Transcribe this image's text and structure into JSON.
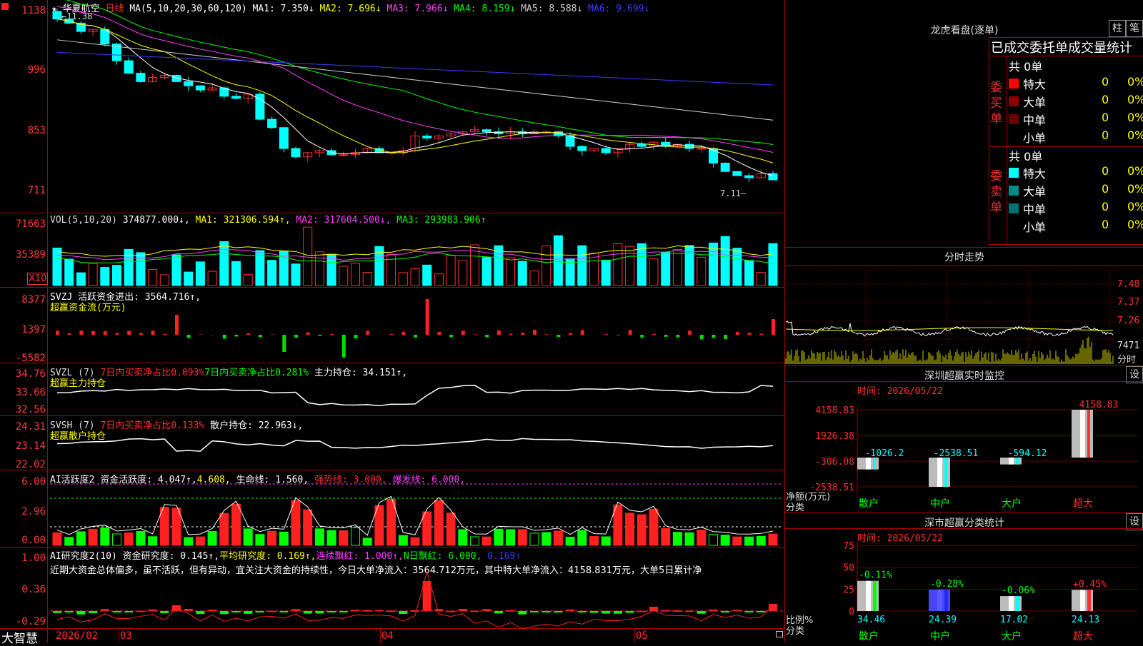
{
  "app": {
    "brand": "大智慧"
  },
  "k": {
    "star": "★",
    "name": "华夏航空",
    "period": "日线",
    "ma_label": "MA(5,10,20,30,60,120)",
    "ma": [
      {
        "t": "MA1: 7.350↓",
        "c": "#ffffff"
      },
      {
        "t": "MA2: 7.696↓",
        "c": "#ffff00"
      },
      {
        "t": "MA3: 7.966↓",
        "c": "#ff40ff"
      },
      {
        "t": "MA4: 8.159↓",
        "c": "#00ff00"
      },
      {
        "t": "MA5: 8.588↓",
        "c": "#d0d0d0"
      },
      {
        "t": "MA6: 9.699↓",
        "c": "#3b3bff"
      }
    ],
    "high_note": "11.38",
    "low_note": "7.11",
    "y": [
      "1138",
      "996",
      "853",
      "711"
    ]
  },
  "vol": {
    "label": "VOL(5,10,20)",
    "v": "374877.000↓,",
    "ma1": "MA1: 321306.594↑,",
    "ma2": "MA2: 317604.500↓,",
    "ma3": "MA3: 293983.906↑",
    "y": [
      "71663",
      "35389"
    ],
    "x10": "X10"
  },
  "svzj": {
    "l1": "SVZJ  活跃资金进出: 3564.716↑,",
    "l2": "超赢资金流(万元)",
    "y": [
      "8377",
      "1397",
      "-5582"
    ]
  },
  "svzl": {
    "p1": "SVZL (7) ",
    "p2": "7日内买卖净占比0.093%",
    "p3": "7日内买卖净占比0.281%",
    "p4": "主力持仓: 34.151↑,",
    "l2": "超赢主力持仓",
    "y": [
      "34.76",
      "33.66",
      "32.56"
    ]
  },
  "svsh": {
    "p1": "SVSH (7) ",
    "p2": "7日内买卖净占比0.133%",
    "p3": "散户持仓: 22.963↓,",
    "l2": "超赢散户持仓",
    "y": [
      "24.31",
      "23.14",
      "22.02"
    ]
  },
  "ai1": {
    "p1": "AI活跃度2 资金活跃度: 4.047↑,",
    "p2": "4.608,",
    "p3": "生命线: 1.560,",
    "p4": "强势线: 3.000,",
    "p5": "爆发线: 6.000,",
    "y": [
      "6.00",
      "2.96",
      "0.00"
    ]
  },
  "ai2": {
    "p1": "AI研究度2(10) 资金研究度: 0.145↑,",
    "p2": "平均研究度: 0.169↑,",
    "p3": "连续飘红: 1.000↑,",
    "p4": "N日飘红: 6.000,",
    "p5": "0.169↑",
    "text": "近期大资金总体偏多，虽不活跃，但有异动，宜关注大资金的持续性，今日大单净流入：3564.712万元，其中特大单净流入：4158.831万元，大单5日累计净",
    "y": [
      "1.00",
      "0.36",
      "-0.29"
    ]
  },
  "dates": [
    "2026/02",
    "03",
    "04",
    "05"
  ],
  "lhb": {
    "title": "龙虎看盘(逐单)",
    "btn1": "柱",
    "btn2": "笔",
    "tabs": "已成交委托单成交量统计",
    "buy": {
      "side": "委买单",
      "total": "共 0单",
      "rows": [
        {
          "n": "特大",
          "v": "0",
          "p": "0%",
          "c": "#ff0000"
        },
        {
          "n": "大单",
          "v": "0",
          "p": "0%",
          "c": "#8b0000"
        },
        {
          "n": "中单",
          "v": "0",
          "p": "0%",
          "c": "#6b0000"
        },
        {
          "n": "小单",
          "v": "0",
          "p": "0%",
          "c": "#000000"
        }
      ]
    },
    "sell": {
      "side": "委卖单",
      "total": "共 0单",
      "rows": [
        {
          "n": "特大",
          "v": "0",
          "p": "0%",
          "c": "#00ffff"
        },
        {
          "n": "大单",
          "v": "0",
          "p": "0%",
          "c": "#008b8b"
        },
        {
          "n": "中单",
          "v": "0",
          "p": "0%",
          "c": "#007070"
        },
        {
          "n": "小单",
          "v": "0",
          "p": "0%",
          "c": "#000000"
        }
      ]
    }
  },
  "fs": {
    "title": "分时走势",
    "y": [
      "7.48",
      "7.37",
      "7.26"
    ],
    "vol": "7471",
    "vlabel": "分时"
  },
  "monitor": {
    "title": "深圳超赢实时监控",
    "btn": "设",
    "time": "时间: 2026/05/22",
    "y": [
      "4158.83",
      "1926.38",
      "-306.08",
      "-2538.51"
    ],
    "bars": [
      {
        "v": "-1026.2",
        "c": "#cccccc"
      },
      {
        "v": "-2538.51",
        "c": "#cccccc"
      },
      {
        "v": "-594.12",
        "c": "#cccccc"
      },
      {
        "v": "4158.83",
        "c": "#cccccc"
      }
    ],
    "cats": [
      "散户",
      "中户",
      "大户",
      "超大"
    ],
    "ylabel": "净额(万元)",
    "xlabel": "分类"
  },
  "stats": {
    "title": "深市超赢分类统计",
    "btn": "设",
    "time": "时间: 2026/05/22",
    "y": [
      "75",
      "50",
      "25",
      "0"
    ],
    "bars": [
      {
        "top": "-0.11%",
        "v": "34.46"
      },
      {
        "top": "-0.28%",
        "v": "24.39"
      },
      {
        "top": "-0.06%",
        "v": "17.02"
      },
      {
        "top": "+0.45%",
        "v": "24.13"
      }
    ],
    "cats": [
      "散户",
      "中户",
      "大户",
      "超大"
    ],
    "ylabel": "比例%",
    "xlabel": "分类"
  }
}
